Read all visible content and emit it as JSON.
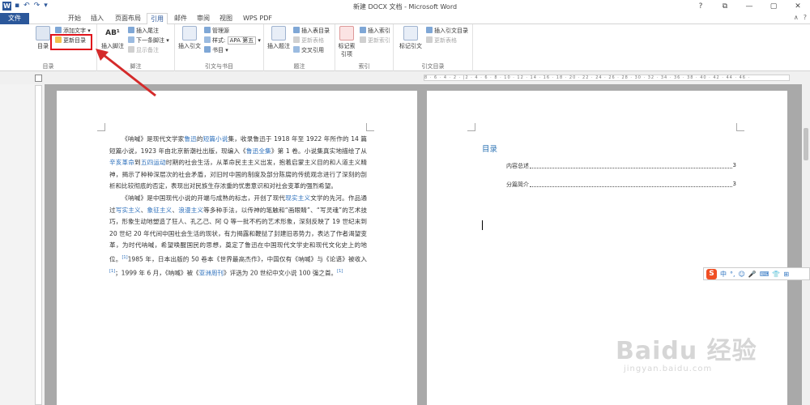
{
  "window": {
    "title": "新建 DOCX 文档 - Microsoft Word",
    "app_letter": "W"
  },
  "tabs": [
    "文件",
    "开始",
    "插入",
    "页面布局",
    "引用",
    "邮件",
    "审阅",
    "视图",
    "WPS PDF"
  ],
  "ribbon": {
    "toc_group": {
      "label": "目录",
      "toc_button": "目录",
      "add_text": "添加文字",
      "update_toc": "更新目录"
    },
    "footnote_group": {
      "label": "脚注",
      "insert_footnote": "插入脚注",
      "insert_endnote": "插入尾注",
      "next_footnote": "下一条脚注",
      "show_notes": "显示备注"
    },
    "citation_group": {
      "label": "引文与书目",
      "insert_citation": "插入引文",
      "manage_sources": "管理源",
      "style_label": "样式:",
      "style_value": "APA 第五",
      "bibliography": "书目"
    },
    "caption_group": {
      "label": "题注",
      "insert_caption": "插入题注",
      "insert_table_of_figures": "插入表目录",
      "update_table": "更新表格",
      "cross_reference": "交叉引用"
    },
    "index_group": {
      "label": "索引",
      "mark_entry": "标记索引项",
      "insert_index": "插入索引",
      "update_index": "更新索引"
    },
    "toa_group": {
      "label": "引文目录",
      "mark_citation": "标记引文",
      "insert_toa": "插入引文目录",
      "update_toa": "更新表格"
    }
  },
  "ruler_text": "8 · 6 · 4 · 2 · |2 · 4 · 6 · 8 · 10 · 12 · 14 · 16 · 18 · 20 · 22 · 24 · 26 · 28 · 30 · 32 · 34 · 36 · 38 · 40 · 42 · 44 · 46 ·",
  "page1": {
    "paragraph1": {
      "pre": "《呐喊》是现代文学家",
      "link1": "鲁迅",
      "mid1": "的",
      "link2": "短篇小说",
      "mid2": "集，收录鲁迅于 1918 年至 1922 年所作的 14 篇短篇小说，1923 年由北京新潮社出版，现编入《",
      "link3": "鲁迅全集",
      "mid3": "》第 1 卷。小说集真实地描绘了从",
      "link4": "辛亥革命",
      "mid4": "到",
      "link5": "五四运动",
      "post": "时期的社会生活，从革命民主主义出发，抱着启蒙主义目的和人道主义精神，揭示了种种深层次的社会矛盾，对旧时中国的制度及部分陈腐的传统观念进行了深刻的剖析和比较彻底的否定，表现出对民族生存浓重的忧患意识和对社会变革的强烈希望。"
    },
    "paragraph2": {
      "pre": "《呐喊》是中国现代小说的开端与成熟的标志，开创了现代",
      "link1": "现实主义",
      "mid1": "文学的先河。作品通过",
      "link2": "写实主义",
      "sep1": "、",
      "link3": "象征主义",
      "sep2": "、",
      "link4": "浪漫主义",
      "mid2": "等多种手法，以传神的笔触和“画眼睛”、“写灵魂”的艺术技巧，形象生动地塑造了狂人、孔乙己、阿 Q 等一批不朽的艺术形象，深刻反映了 19 世纪末到 20 世纪 20 年代间中国社会生活的现状，有力揭露和鞭挞了封建旧恶势力，表达了作者渴望变革，为时代呐喊，希望唤醒国民的思想，奠定了鲁迅在中国现代文学史和现代文化史上的地位。",
      "ref1": "[1]",
      "mid3": "1985 年，日本出版的 50 卷本《世界最高杰作》，中国仅有《呐喊》与《论语》被收入",
      "ref2": "[1]",
      "mid4": "；1999 年 6 月，《呐喊》被《",
      "link5": "亚洲周刊",
      "post": "》评选为 20 世纪中文小说 100 强之首。",
      "ref3": "[1]"
    }
  },
  "page2": {
    "toc_heading": "目录",
    "entries": [
      {
        "text": "内容总述",
        "page": "3"
      },
      {
        "text": "分篇简介",
        "page": "3"
      }
    ]
  },
  "ime": {
    "logo": "S",
    "mode": "中",
    "items": [
      "°,",
      "☺",
      "🎤",
      "⌨",
      "👕",
      "⊞"
    ]
  },
  "watermark": {
    "brand": "Baidu 经验",
    "url": "jingyan.baidu.com"
  },
  "colors": {
    "accent": "#2b579a",
    "highlight": "#e0141b",
    "link": "#2a6ebb",
    "toc_heading": "#2e74b5"
  }
}
